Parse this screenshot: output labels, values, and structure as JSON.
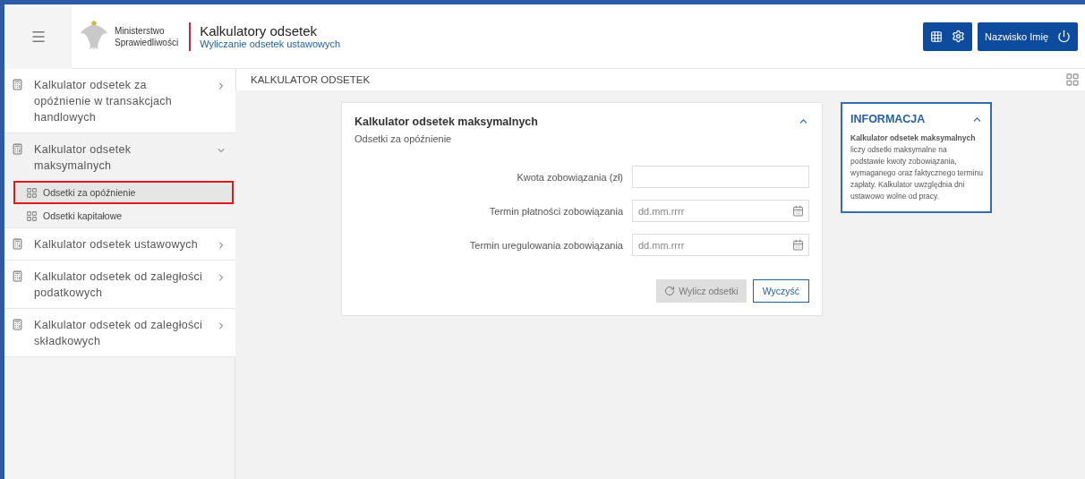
{
  "header": {
    "ministry_line1": "Ministerstwo",
    "ministry_line2": "Sprawiedliwości",
    "title": "Kalkulatory odsetek",
    "subtitle": "Wyliczanie odsetek ustawowych",
    "user_name": "Nazwisko Imię"
  },
  "sidebar": {
    "items": [
      {
        "label": "Kalkulator odsetek za opóźnienie w transakcjach handlowych",
        "expanded": false
      },
      {
        "label": "Kalkulator odsetek maksymalnych",
        "expanded": true,
        "children": [
          {
            "label": "Odsetki za opóźnienie",
            "selected": true
          },
          {
            "label": "Odsetki kapitałowe",
            "selected": false
          }
        ]
      },
      {
        "label": "Kalkulator odsetek ustawowych",
        "expanded": false
      },
      {
        "label": "Kalkulator odsetek od zaległości podatkowych",
        "expanded": false
      },
      {
        "label": "Kalkulator odsetek od zaległości składkowych",
        "expanded": false
      }
    ]
  },
  "breadcrumb": "KALKULATOR ODSETEK",
  "form": {
    "title": "Kalkulator odsetek maksymalnych",
    "subtitle": "Odsetki za opóźnienie",
    "expanded": true,
    "fields": [
      {
        "kind": "text",
        "label": "Kwota zobowiązania (zł)"
      },
      {
        "kind": "date",
        "label": "Termin płatności zobowiązania",
        "placeholder": "dd.mm.rrrr"
      },
      {
        "kind": "date",
        "label": "Termin uregulowania zobowiązania",
        "placeholder": "dd.mm.rrrr"
      }
    ],
    "calculate_button": {
      "label": "Wylicz odsetki",
      "disabled": true
    },
    "clear_button": "Wyczyść"
  },
  "info": {
    "title": "INFORMACJA",
    "expanded": true,
    "text": "**Kalkulator odsetek maksymalnych** liczy odsetki maksymalne na podstawie kwoty zobowiązania, wymaganego oraz faktycznego terminu zapłaty. Kalkulator uwzględnia dni ustawowo wolne od pracy."
  }
}
